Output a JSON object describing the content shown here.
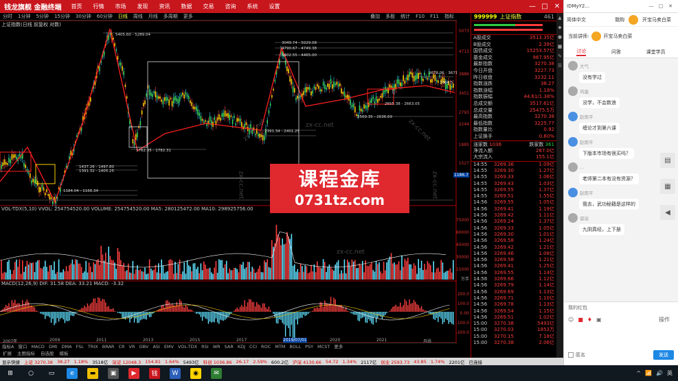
{
  "app": {
    "logo": "钱龙旗舰 金融终端",
    "menu": [
      "首页",
      "行情",
      "市场",
      "发现",
      "资讯",
      "数据",
      "交易",
      "咨询",
      "系统",
      "设置"
    ],
    "window_buttons": [
      "—",
      "□",
      "✕"
    ]
  },
  "toolbar": {
    "periods": [
      "分时",
      "1分钟",
      "5分钟",
      "15分钟",
      "30分钟",
      "60分钟",
      "日线",
      "周线",
      "月线",
      "多周期",
      "更多"
    ],
    "active": "日线",
    "tools": [
      "叠加",
      "多股",
      "统计",
      "F10",
      "F11",
      "指标"
    ]
  },
  "chart": {
    "title": "上证指数(日线 前复权 对数)",
    "price_annotations": [
      "5405.60 - 5289.04",
      "3049.74 - 5029.08",
      "4790.67 - 4749.38",
      "4402.55 - 4465.00",
      "1762.35 - 1782.31",
      "1437.26 - 1497.80",
      "1391.32 - 1405.25",
      "1184.04 - 1166.34",
      "3678.06 - 3671.63",
      "3364.5",
      "2655.38 - 2663.05",
      "2569.35 - 2636.69",
      "2391.34 - 2401.25"
    ],
    "yaxis_labels": [
      "5073",
      "4713",
      "3886",
      "3451",
      "2793",
      "2244",
      "1885",
      "1527",
      "1186.7"
    ],
    "volume_title": "VOL-TDX(5,10)  VVOL: 254754520.00  VOLUME: 254754520.00  MA5: 280125472.00  MA10: 298925756.00",
    "volume_yaxis": [
      "75000",
      "60000",
      "45000",
      "30000",
      "15000",
      "万手"
    ],
    "macd_title": "MACD(12,26,9)  DIF: 31.58  DEA: 33.21  MACD: -3.32",
    "macd_yaxis": [
      "200.0",
      "100.0",
      "0.00",
      "-100.0",
      "-200.0"
    ],
    "date_axis": [
      "2007年",
      "2009",
      "2011",
      "2013",
      "2015",
      "2017",
      "2019/07/01",
      "2020",
      "2021",
      "月线"
    ],
    "bottom_tabs": [
      "指标A",
      "窗口",
      "MACD",
      "DMI",
      "DMA",
      "FSL",
      "TRIX",
      "BRAR",
      "CR",
      "VR",
      "OBV",
      "ASI",
      "EMV",
      "VOL-TDX",
      "RSI",
      "WR",
      "SAR",
      "KDJ",
      "CCI",
      "ROC",
      "MTM",
      "BOLL",
      "PSY",
      "MCST",
      "更多"
    ],
    "bottom_tabs2": [
      "扩展",
      "主图指标",
      "自选股",
      "模板"
    ]
  },
  "quote": {
    "code": "999999",
    "name": "上证指数",
    "rank": "461",
    "rows": [
      {
        "k": "A股成交",
        "v": "3513.35亿"
      },
      {
        "k": "B股成交",
        "v": "2.39亿"
      },
      {
        "k": "国债成交",
        "v": "15253.57亿"
      },
      {
        "k": "基金成交",
        "v": "967.95亿"
      },
      {
        "k": "最新指数",
        "v": "3270.38"
      },
      {
        "k": "今日开盘",
        "v": "3227.73"
      },
      {
        "k": "昨日收盘",
        "v": "3232.11"
      },
      {
        "k": "指数涨跌",
        "v": "38.27"
      },
      {
        "k": "指数涨幅",
        "v": "1.18%"
      },
      {
        "k": "指数振幅",
        "v": "44.61/1.38%"
      },
      {
        "k": "总成交额",
        "v": "3517.61亿"
      },
      {
        "k": "总成交量",
        "v": "25475.5万"
      },
      {
        "k": "最高指数",
        "v": "3270.38"
      },
      {
        "k": "最低指数",
        "v": "3225.77"
      },
      {
        "k": "指数量比",
        "v": "0.92"
      },
      {
        "k": "上证换手",
        "v": "0.60%"
      }
    ],
    "updown": {
      "up_label": "涨家数",
      "up": "1036",
      "down_label": "跌家数",
      "down": "361"
    },
    "flow": [
      {
        "k": "净流入额",
        "v": "287.0亿"
      },
      {
        "k": "大宗流入",
        "v": "155.1亿"
      }
    ],
    "ticks": [
      {
        "t": "14:55",
        "p": "3269.36",
        "v": "1.09亿"
      },
      {
        "t": "14:55",
        "p": "3269.30",
        "v": "1.27亿"
      },
      {
        "t": "14:55",
        "p": "3269.33",
        "v": "1.06亿"
      },
      {
        "t": "14:55",
        "p": "3269.43",
        "v": "1.03亿"
      },
      {
        "t": "14:55",
        "p": "3269.55",
        "v": "1.37亿"
      },
      {
        "t": "14:55",
        "p": "3269.51",
        "v": "1.55亿"
      },
      {
        "t": "14:56",
        "p": "3269.55",
        "v": "1.05亿"
      },
      {
        "t": "14:56",
        "p": "3269.41",
        "v": "1.19亿"
      },
      {
        "t": "14:56",
        "p": "3269.42",
        "v": "1.11亿"
      },
      {
        "t": "14:56",
        "p": "3269.24",
        "v": "1.37亿"
      },
      {
        "t": "14:56",
        "p": "3269.33",
        "v": "1.05亿"
      },
      {
        "t": "14:56",
        "p": "3269.30",
        "v": "1.01亿"
      },
      {
        "t": "14:56",
        "p": "3269.58",
        "v": "1.24亿"
      },
      {
        "t": "14:56",
        "p": "3269.42",
        "v": "1.21亿"
      },
      {
        "t": "14:56",
        "p": "3269.46",
        "v": "1.08亿"
      },
      {
        "t": "14:56",
        "p": "3269.58",
        "v": "1.21亿"
      },
      {
        "t": "14:56",
        "p": "3269.41",
        "v": "1.25亿"
      },
      {
        "t": "14:56",
        "p": "3269.55",
        "v": "1.14亿"
      },
      {
        "t": "14:56",
        "p": "3269.66",
        "v": "1.12亿"
      },
      {
        "t": "14:56",
        "p": "3269.79",
        "v": "1.14亿"
      },
      {
        "t": "14:56",
        "p": "3269.69",
        "v": "1.13亿"
      },
      {
        "t": "14:56",
        "p": "3269.71",
        "v": "1.10亿"
      },
      {
        "t": "14:56",
        "p": "3269.78",
        "v": "1.13亿"
      },
      {
        "t": "14:56",
        "p": "3269.54",
        "v": "1.15亿"
      },
      {
        "t": "14:56",
        "p": "3269.51",
        "v": "1.02亿"
      },
      {
        "t": "15:00",
        "p": "3270.38",
        "v": "5493亿"
      },
      {
        "t": "15:00",
        "p": "3270.03",
        "v": "1853万"
      },
      {
        "t": "15:00",
        "p": "3270.15",
        "v": "7.18亿"
      },
      {
        "t": "15:00",
        "p": "3270.38",
        "v": "2.06亿"
      }
    ]
  },
  "statusbar": {
    "items": [
      {
        "t": "显示快捷",
        "c": ""
      },
      {
        "t": "上证 3270.38",
        "c": "r"
      },
      {
        "t": "38.27",
        "c": "r"
      },
      {
        "t": "1.18%",
        "c": "r"
      },
      {
        "t": "3518亿",
        "c": ""
      },
      {
        "t": "深证 12048.3",
        "c": "r"
      },
      {
        "t": "154.81",
        "c": "r"
      },
      {
        "t": "1.64%",
        "c": "r"
      },
      {
        "t": "5493亿",
        "c": ""
      },
      {
        "t": "科创 1036.86",
        "c": "r"
      },
      {
        "t": "26.17",
        "c": "r"
      },
      {
        "t": "2.59%",
        "c": "r"
      },
      {
        "t": "600.2亿",
        "c": ""
      },
      {
        "t": "沪深 4130.66",
        "c": "r"
      },
      {
        "t": "54.72",
        "c": "r"
      },
      {
        "t": "1.34%",
        "c": "r"
      },
      {
        "t": "2117亿",
        "c": ""
      },
      {
        "t": "创业 2593.73",
        "c": "r"
      },
      {
        "t": "43.85",
        "c": "r"
      },
      {
        "t": "1.74%",
        "c": "r"
      },
      {
        "t": "2201亿",
        "c": ""
      },
      {
        "t": "已连接",
        "c": ""
      }
    ]
  },
  "chat": {
    "window_title": "IDMyY2...",
    "nav": [
      "简体中文",
      "我购",
      "开宝马卖白菜"
    ],
    "anchor_label": "当前讲师:",
    "anchor_name": "开宝马卖白菜",
    "tabs": [
      "讨论",
      "问答",
      "课堂学员"
    ],
    "active_tab": "讨论",
    "messages": [
      {
        "who": "大气",
        "text": "没有学过",
        "av": "g"
      },
      {
        "who": "鸡蛋",
        "text": "没学，不会数浪",
        "av": "g"
      },
      {
        "who": "赵雨平",
        "text": "缠论才到第六课",
        "av": "b"
      },
      {
        "who": "赵雨平",
        "text": "下版本市场有很买吗？",
        "av": "b"
      },
      {
        "who": "...",
        "text": "老师第二本有没有资源？",
        "av": "g"
      },
      {
        "who": "赵雨平",
        "text": "我去，武功秘籍是这样的",
        "av": "b"
      },
      {
        "who": "留溢",
        "text": "九阴真经，上下册",
        "av": "g"
      }
    ],
    "input_placeholder": "我的红包",
    "anon_label": "匿名",
    "send_label": "发送",
    "action_label": "操作"
  },
  "promo": {
    "line1": "课程金库",
    "line2": "0731tz.com"
  },
  "watermarks": [
    "zx-cc.net",
    "zx-cc.net",
    "zx-cc.net",
    "zx-cc.net",
    "zx-cc.net",
    "zx-cc.net"
  ],
  "taskbar": {
    "ime": "英",
    "tray_icons": [
      "^",
      "📶",
      "🔊"
    ]
  }
}
